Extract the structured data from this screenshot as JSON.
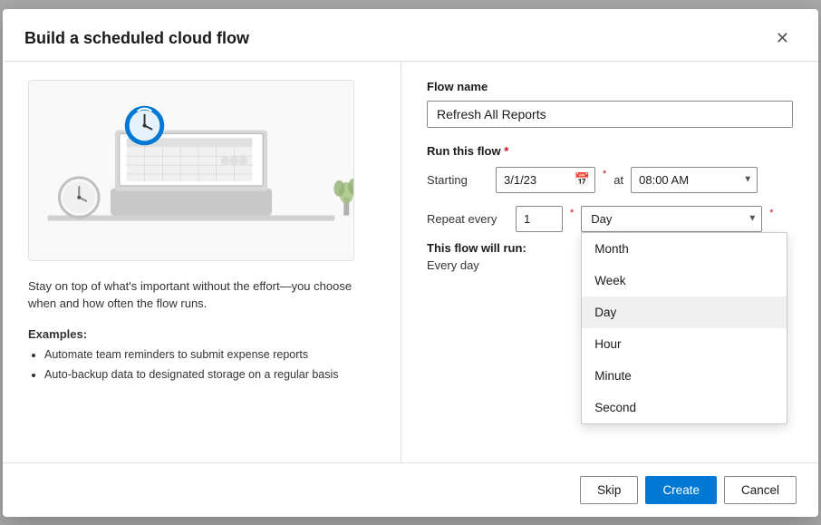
{
  "dialog": {
    "title": "Build a scheduled cloud flow",
    "close_label": "✕"
  },
  "left": {
    "description": "Stay on top of what's important without the effort—you choose when and how often the flow runs.",
    "examples_title": "Examples:",
    "examples": [
      "Automate team reminders to submit expense reports",
      "Auto-backup data to designated storage on a regular basis"
    ]
  },
  "right": {
    "flow_name_label": "Flow name",
    "flow_name_value": "Refresh All Reports",
    "run_section_label": "Run this flow",
    "required_indicator": "*",
    "starting_label": "Starting",
    "date_value": "3/1/23",
    "at_label": "at",
    "time_value": "08:00 AM",
    "repeat_label": "Repeat every",
    "repeat_number": "1",
    "repeat_unit": "Day",
    "flow_will_run_title": "This flow will run:",
    "flow_will_run_value": "Every day",
    "dropdown_options": [
      {
        "label": "Month",
        "selected": false
      },
      {
        "label": "Week",
        "selected": false
      },
      {
        "label": "Day",
        "selected": true
      },
      {
        "label": "Hour",
        "selected": false
      },
      {
        "label": "Minute",
        "selected": false
      },
      {
        "label": "Second",
        "selected": false
      }
    ]
  },
  "footer": {
    "skip_label": "Skip",
    "create_label": "Create",
    "cancel_label": "Cancel"
  }
}
